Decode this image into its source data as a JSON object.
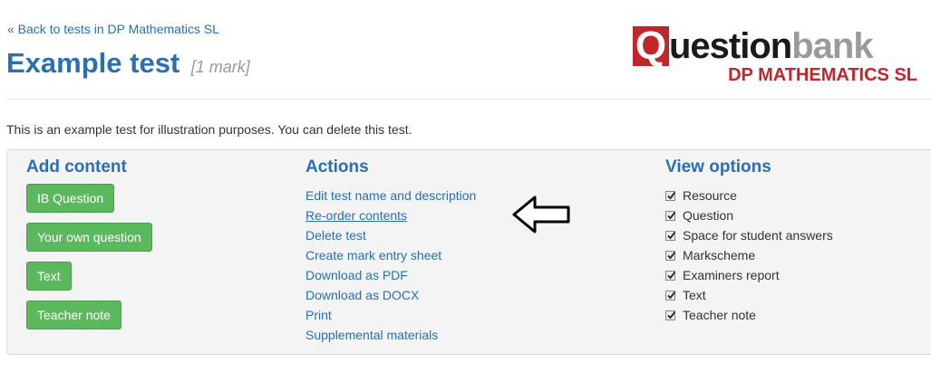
{
  "header": {
    "back_link": "« Back to tests in DP Mathematics SL",
    "title": "Example test",
    "marks": "[1 mark]"
  },
  "logo": {
    "q": "Q",
    "word_dark": "uestion",
    "word_light": "bank",
    "subtitle": "DP MATHEMATICS SL"
  },
  "description": "This is an example test for illustration purposes. You can delete this test.",
  "add_content": {
    "heading": "Add content",
    "buttons": [
      "IB Question",
      "Your own question",
      "Text",
      "Teacher note"
    ]
  },
  "actions": {
    "heading": "Actions",
    "items": [
      "Edit test name and description",
      "Re-order contents",
      "Delete test",
      "Create mark entry sheet",
      "Download as PDF",
      "Download as DOCX",
      "Print",
      "Supplemental materials"
    ]
  },
  "view_options": {
    "heading": "View options",
    "items": [
      {
        "label": "Resource",
        "checked": true
      },
      {
        "label": "Question",
        "checked": true
      },
      {
        "label": "Space for student answers",
        "checked": true
      },
      {
        "label": "Markscheme",
        "checked": true
      },
      {
        "label": "Examiners report",
        "checked": true
      },
      {
        "label": "Text",
        "checked": true
      },
      {
        "label": "Teacher note",
        "checked": true
      }
    ]
  },
  "colors": {
    "link": "#2a6fb3",
    "button_green": "#5cb85c",
    "brand_red": "#c0272d"
  }
}
